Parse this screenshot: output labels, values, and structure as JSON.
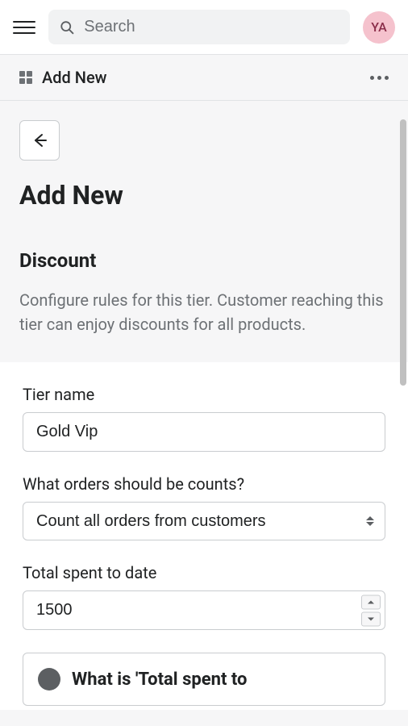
{
  "topbar": {
    "search_placeholder": "Search",
    "avatar_initials": "YA"
  },
  "subheader": {
    "title": "Add New"
  },
  "page": {
    "title": "Add New"
  },
  "section": {
    "heading": "Discount",
    "description": "Configure rules for this tier. Customer reaching this tier can enjoy discounts for all products."
  },
  "form": {
    "tier_name": {
      "label": "Tier name",
      "value": "Gold Vip"
    },
    "orders_count": {
      "label": "What orders should be counts?",
      "selected": "Count all orders from customers"
    },
    "total_spent": {
      "label": "Total spent to date",
      "value": "1500"
    },
    "info": {
      "text": "What is 'Total spent to"
    }
  }
}
